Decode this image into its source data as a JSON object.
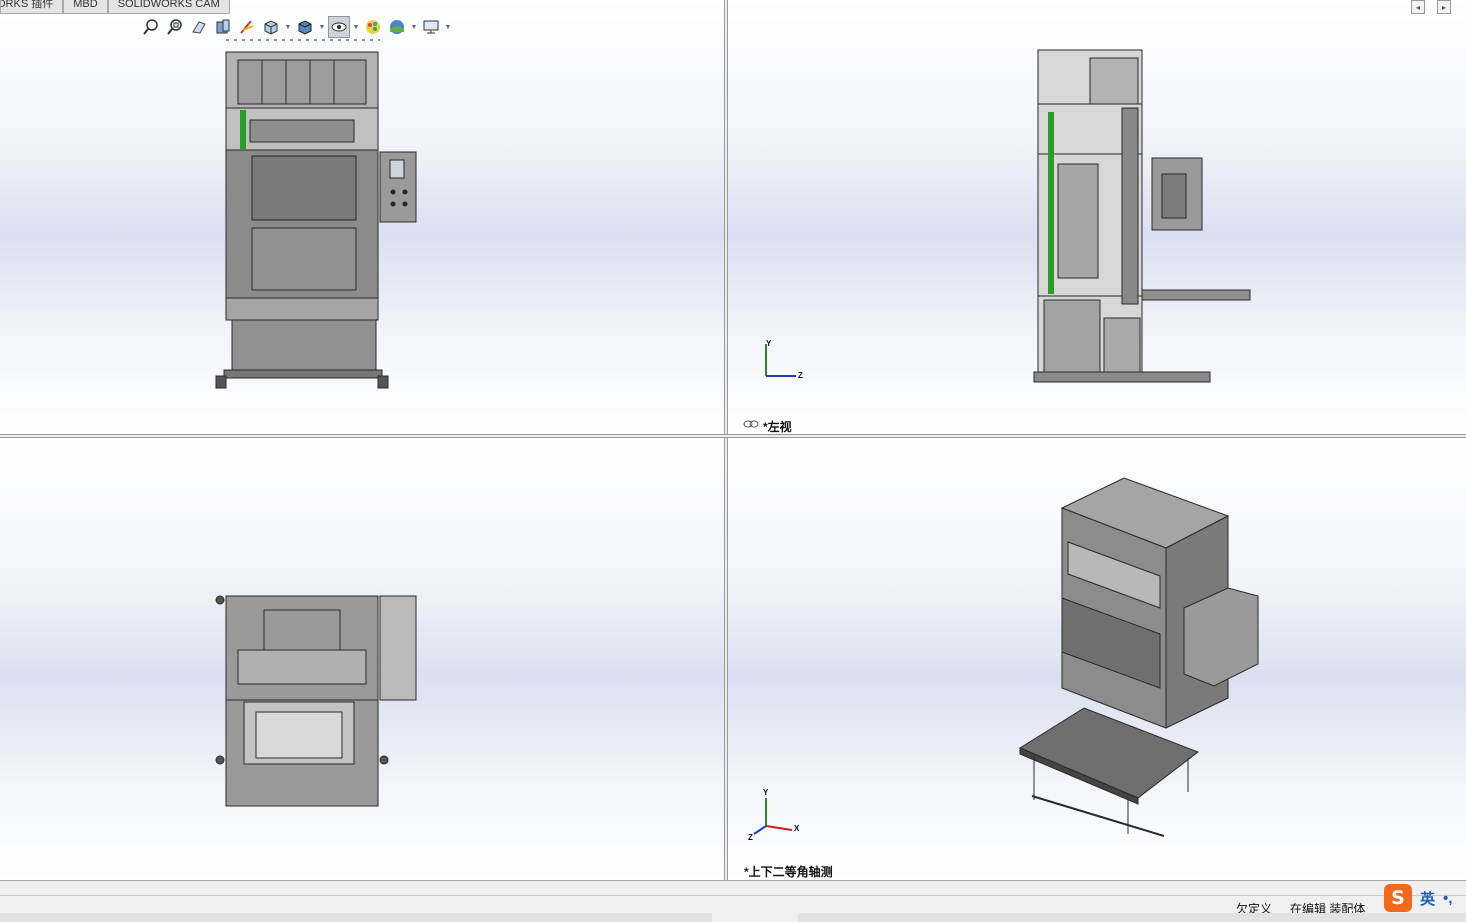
{
  "tabs": [
    "ORKS 插件",
    "MBD",
    "SOLIDWORKS CAM"
  ],
  "hud_icons": [
    "zoom-to-fit-icon",
    "zoom-to-area-icon",
    "previous-view-icon",
    "section-view-icon",
    "dynamic-annotation-icon",
    "view-orientation-icon",
    "display-style-icon",
    "hide-show-items-icon",
    "edit-appearance-icon",
    "apply-scene-icon",
    "view-settings-icon"
  ],
  "viewports": {
    "top_left": {
      "label": ""
    },
    "top_right": {
      "label": "*左视",
      "link_icon": "link-views-icon",
      "triad": {
        "y": "Y",
        "z": "Z"
      }
    },
    "bottom_left": {
      "label": ""
    },
    "bottom_right": {
      "label": "*上下二等角轴测",
      "triad": {
        "y": "Y",
        "x": "X",
        "z": "Z"
      }
    }
  },
  "corner_buttons": [
    "◂",
    "▸"
  ],
  "status": {
    "definition": "欠定义",
    "mode": "在编辑 装配体"
  },
  "ime": {
    "logo": "S",
    "lang": "英",
    "punct": "•,"
  },
  "colors": {
    "viewport_mid": "#dcdff0",
    "machine_steel": "#7d7d7d",
    "green_pipe": "#2c9a2c",
    "ime_orange": "#f06a1e"
  }
}
